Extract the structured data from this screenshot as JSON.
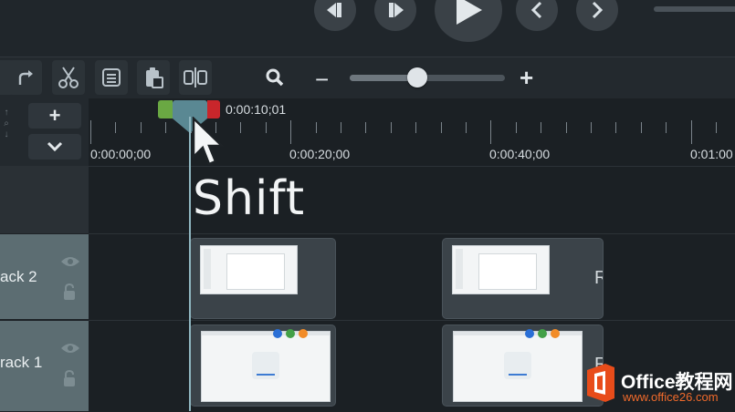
{
  "transport": {
    "buttons": [
      "previous-frame",
      "next-frame",
      "play",
      "previous-marker",
      "next-marker"
    ]
  },
  "toolbar": {
    "icons": [
      "redo-icon",
      "cut-icon",
      "copy-icon",
      "paste-icon",
      "split-icon",
      "zoom-icon"
    ],
    "zoom_minus": "−",
    "zoom_plus": "+",
    "zoom_level": 0.42
  },
  "side": {
    "add_track": "+",
    "collapse": "⌄"
  },
  "playhead": {
    "time": "0:00:10;01",
    "in_color": "#6aa843",
    "out_color": "#c9262b"
  },
  "ruler": {
    "labels": [
      "0:00:00;00",
      "0:00:20;00",
      "0:00:40;00",
      "0:01:00"
    ]
  },
  "tracks": [
    {
      "label": "ack 2",
      "clip_suffix": "R"
    },
    {
      "label": "rack 1",
      "clip_suffix": "R"
    }
  ],
  "caption": "Shift",
  "watermark": {
    "title": "Office教程网",
    "url": "www.office26.com"
  },
  "colors": {
    "track_head": "#5c6d72",
    "playhead": "#5a8893",
    "accent": "#f06a2b"
  }
}
